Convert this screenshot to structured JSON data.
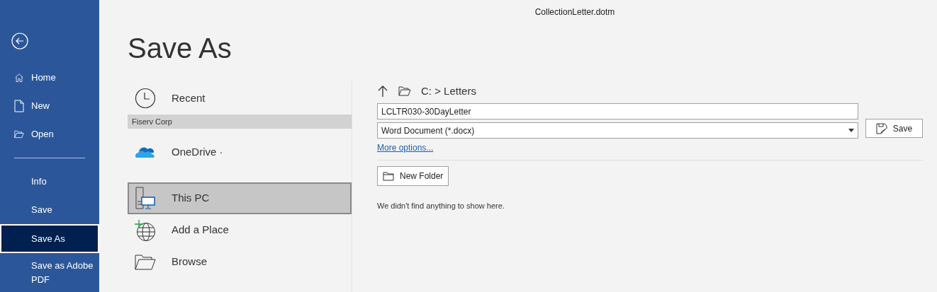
{
  "window": {
    "title": "CollectionLetter.dotm"
  },
  "sidebar": {
    "items": [
      {
        "label": "Home",
        "kind": "home",
        "selected": false
      },
      {
        "label": "New",
        "kind": "new",
        "selected": false
      },
      {
        "label": "Open",
        "kind": "open",
        "selected": false
      },
      {
        "kind": "divider"
      },
      {
        "label": "Info",
        "kind": "plain",
        "selected": false
      },
      {
        "label": "Save",
        "kind": "plain",
        "selected": false
      },
      {
        "label": "Save As",
        "kind": "plain",
        "selected": true
      },
      {
        "label": "Save as Adobe PDF",
        "kind": "plain",
        "selected": false
      }
    ]
  },
  "heading": "Save As",
  "locations": [
    {
      "label": "Recent",
      "kind": "recent",
      "selected": false
    },
    {
      "label": "Fiserv Corp",
      "kind": "group"
    },
    {
      "label": "OneDrive ·",
      "kind": "onedrive",
      "selected": false
    },
    {
      "label": "This PC",
      "kind": "pc",
      "selected": true
    },
    {
      "label": "Add a Place",
      "kind": "addplace",
      "selected": false
    },
    {
      "label": "Browse",
      "kind": "browse",
      "selected": false
    }
  ],
  "path": "C: > Letters",
  "file_name": {
    "value": "LCLTR030-30DayLetter"
  },
  "file_type": {
    "value": "Word Document (*.docx)"
  },
  "save_button": "Save",
  "more_options": "More options...",
  "new_folder_button": "New Folder",
  "empty_message": "We didn't find anything to show here."
}
